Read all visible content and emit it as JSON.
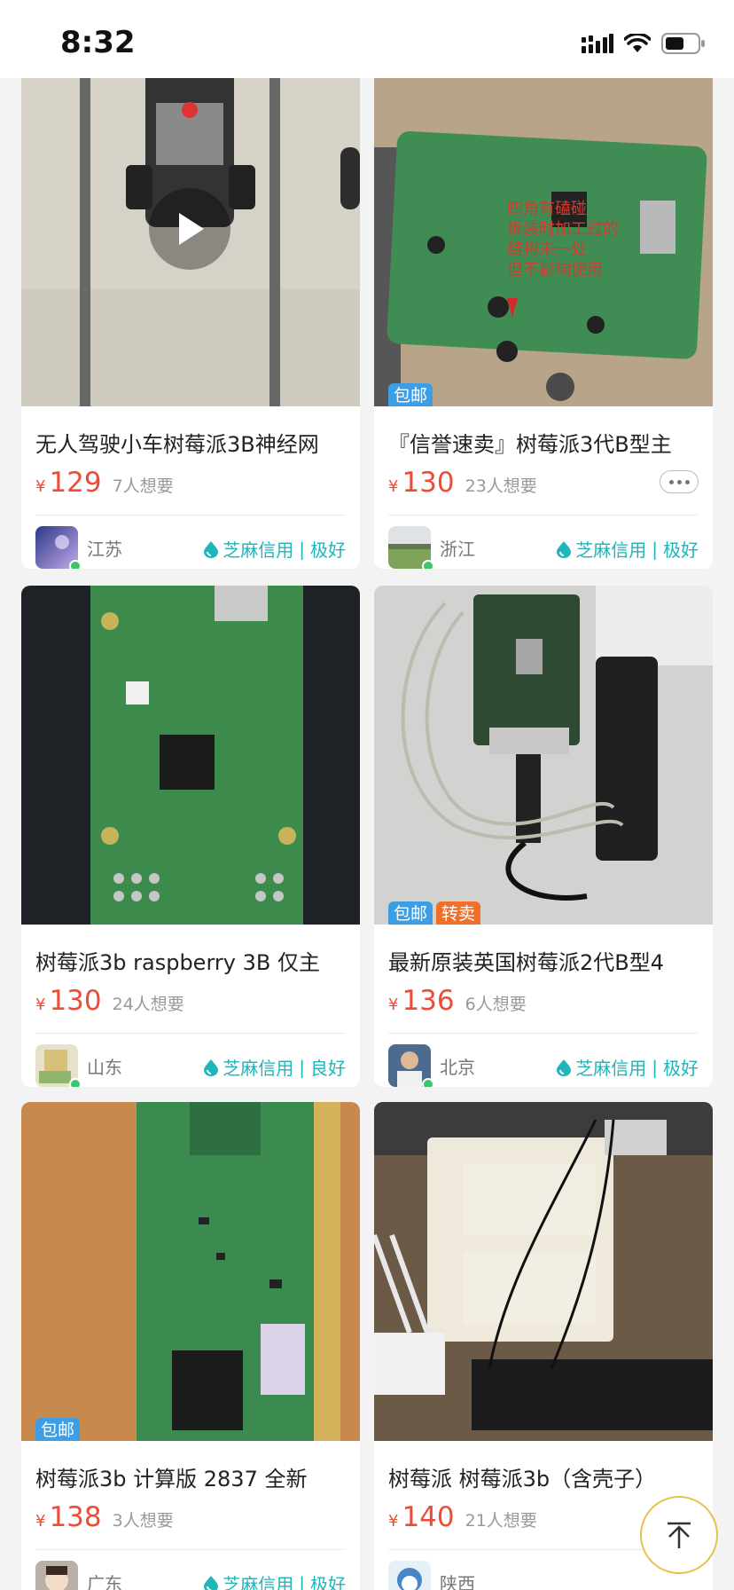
{
  "status_bar": {
    "time": "8:32"
  },
  "listings": [
    {
      "title": "无人驾驶小车树莓派3B神经网",
      "currency": "¥",
      "price": "129",
      "wants": "7人想要",
      "region": "江苏",
      "credit_label": "芝麻信用",
      "credit_level": "极好",
      "badges": [],
      "has_video": true
    },
    {
      "title": "『信誉速卖』树莓派3代B型主",
      "currency": "¥",
      "price": "130",
      "wants": "23人想要",
      "region": "浙江",
      "credit_label": "芝麻信用",
      "credit_level": "极好",
      "badges": [
        "包邮"
      ],
      "photo_caption": "四角有磕碰\n拆装时加工过的\n结构未一处\n但不影响使用"
    },
    {
      "title": "树莓派3b raspberry 3B 仅主",
      "currency": "¥",
      "price": "130",
      "wants": "24人想要",
      "region": "山东",
      "credit_label": "芝麻信用",
      "credit_level": "良好",
      "badges": []
    },
    {
      "title": "最新原装英国树莓派2代B型4",
      "currency": "¥",
      "price": "136",
      "wants": "6人想要",
      "region": "北京",
      "credit_label": "芝麻信用",
      "credit_level": "极好",
      "badges": [
        "包邮",
        "转卖"
      ]
    },
    {
      "title": "树莓派3b 计算版 2837 全新",
      "currency": "¥",
      "price": "138",
      "wants": "3人想要",
      "region": "广东",
      "credit_label": "芝麻信用",
      "credit_level": "极好",
      "badges": [
        "包邮"
      ]
    },
    {
      "title": "树莓派  树莓派3b（含壳子）",
      "currency": "¥",
      "price": "140",
      "wants": "21人想要",
      "region": "陕西",
      "credit_label": "",
      "credit_level": "",
      "badges": []
    }
  ],
  "colors": {
    "price": "#ef4c36",
    "credit": "#1fb5b9",
    "free_ship_badge": "#3d9ee6",
    "resale_badge": "#f0702a",
    "online_dot": "#3cc56c"
  },
  "icons": {
    "signal": "cellular-signal-icon",
    "wifi": "wifi-icon",
    "battery": "battery-icon",
    "play": "play-icon",
    "more": "more-dots-icon",
    "credit": "sesame-credit-icon",
    "back_to_top": "arrow-up-icon"
  }
}
